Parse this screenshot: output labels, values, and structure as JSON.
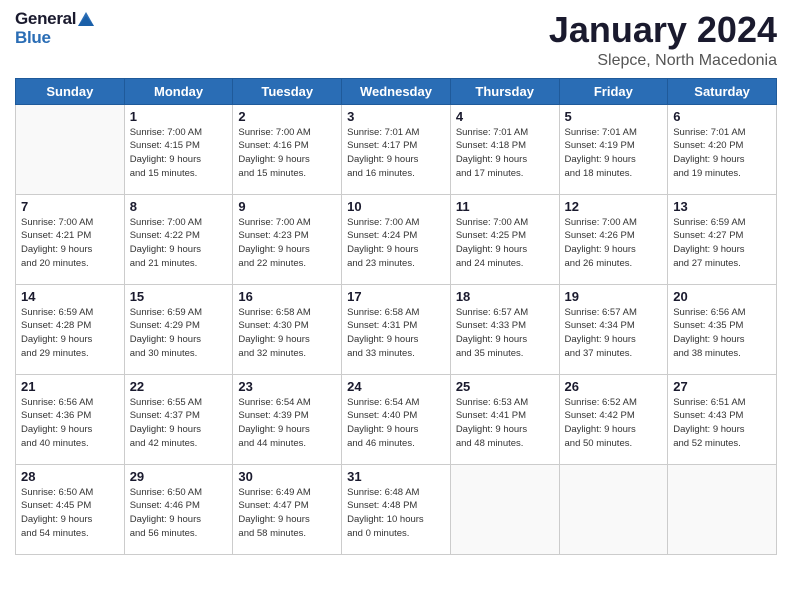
{
  "logo": {
    "line1": "General",
    "line2": "Blue"
  },
  "title": "January 2024",
  "location": "Slepce, North Macedonia",
  "days_of_week": [
    "Sunday",
    "Monday",
    "Tuesday",
    "Wednesday",
    "Thursday",
    "Friday",
    "Saturday"
  ],
  "weeks": [
    [
      {
        "day": "",
        "info": ""
      },
      {
        "day": "1",
        "info": "Sunrise: 7:00 AM\nSunset: 4:15 PM\nDaylight: 9 hours\nand 15 minutes."
      },
      {
        "day": "2",
        "info": "Sunrise: 7:00 AM\nSunset: 4:16 PM\nDaylight: 9 hours\nand 15 minutes."
      },
      {
        "day": "3",
        "info": "Sunrise: 7:01 AM\nSunset: 4:17 PM\nDaylight: 9 hours\nand 16 minutes."
      },
      {
        "day": "4",
        "info": "Sunrise: 7:01 AM\nSunset: 4:18 PM\nDaylight: 9 hours\nand 17 minutes."
      },
      {
        "day": "5",
        "info": "Sunrise: 7:01 AM\nSunset: 4:19 PM\nDaylight: 9 hours\nand 18 minutes."
      },
      {
        "day": "6",
        "info": "Sunrise: 7:01 AM\nSunset: 4:20 PM\nDaylight: 9 hours\nand 19 minutes."
      }
    ],
    [
      {
        "day": "7",
        "info": "Sunrise: 7:00 AM\nSunset: 4:21 PM\nDaylight: 9 hours\nand 20 minutes."
      },
      {
        "day": "8",
        "info": "Sunrise: 7:00 AM\nSunset: 4:22 PM\nDaylight: 9 hours\nand 21 minutes."
      },
      {
        "day": "9",
        "info": "Sunrise: 7:00 AM\nSunset: 4:23 PM\nDaylight: 9 hours\nand 22 minutes."
      },
      {
        "day": "10",
        "info": "Sunrise: 7:00 AM\nSunset: 4:24 PM\nDaylight: 9 hours\nand 23 minutes."
      },
      {
        "day": "11",
        "info": "Sunrise: 7:00 AM\nSunset: 4:25 PM\nDaylight: 9 hours\nand 24 minutes."
      },
      {
        "day": "12",
        "info": "Sunrise: 7:00 AM\nSunset: 4:26 PM\nDaylight: 9 hours\nand 26 minutes."
      },
      {
        "day": "13",
        "info": "Sunrise: 6:59 AM\nSunset: 4:27 PM\nDaylight: 9 hours\nand 27 minutes."
      }
    ],
    [
      {
        "day": "14",
        "info": "Sunrise: 6:59 AM\nSunset: 4:28 PM\nDaylight: 9 hours\nand 29 minutes."
      },
      {
        "day": "15",
        "info": "Sunrise: 6:59 AM\nSunset: 4:29 PM\nDaylight: 9 hours\nand 30 minutes."
      },
      {
        "day": "16",
        "info": "Sunrise: 6:58 AM\nSunset: 4:30 PM\nDaylight: 9 hours\nand 32 minutes."
      },
      {
        "day": "17",
        "info": "Sunrise: 6:58 AM\nSunset: 4:31 PM\nDaylight: 9 hours\nand 33 minutes."
      },
      {
        "day": "18",
        "info": "Sunrise: 6:57 AM\nSunset: 4:33 PM\nDaylight: 9 hours\nand 35 minutes."
      },
      {
        "day": "19",
        "info": "Sunrise: 6:57 AM\nSunset: 4:34 PM\nDaylight: 9 hours\nand 37 minutes."
      },
      {
        "day": "20",
        "info": "Sunrise: 6:56 AM\nSunset: 4:35 PM\nDaylight: 9 hours\nand 38 minutes."
      }
    ],
    [
      {
        "day": "21",
        "info": "Sunrise: 6:56 AM\nSunset: 4:36 PM\nDaylight: 9 hours\nand 40 minutes."
      },
      {
        "day": "22",
        "info": "Sunrise: 6:55 AM\nSunset: 4:37 PM\nDaylight: 9 hours\nand 42 minutes."
      },
      {
        "day": "23",
        "info": "Sunrise: 6:54 AM\nSunset: 4:39 PM\nDaylight: 9 hours\nand 44 minutes."
      },
      {
        "day": "24",
        "info": "Sunrise: 6:54 AM\nSunset: 4:40 PM\nDaylight: 9 hours\nand 46 minutes."
      },
      {
        "day": "25",
        "info": "Sunrise: 6:53 AM\nSunset: 4:41 PM\nDaylight: 9 hours\nand 48 minutes."
      },
      {
        "day": "26",
        "info": "Sunrise: 6:52 AM\nSunset: 4:42 PM\nDaylight: 9 hours\nand 50 minutes."
      },
      {
        "day": "27",
        "info": "Sunrise: 6:51 AM\nSunset: 4:43 PM\nDaylight: 9 hours\nand 52 minutes."
      }
    ],
    [
      {
        "day": "28",
        "info": "Sunrise: 6:50 AM\nSunset: 4:45 PM\nDaylight: 9 hours\nand 54 minutes."
      },
      {
        "day": "29",
        "info": "Sunrise: 6:50 AM\nSunset: 4:46 PM\nDaylight: 9 hours\nand 56 minutes."
      },
      {
        "day": "30",
        "info": "Sunrise: 6:49 AM\nSunset: 4:47 PM\nDaylight: 9 hours\nand 58 minutes."
      },
      {
        "day": "31",
        "info": "Sunrise: 6:48 AM\nSunset: 4:48 PM\nDaylight: 10 hours\nand 0 minutes."
      },
      {
        "day": "",
        "info": ""
      },
      {
        "day": "",
        "info": ""
      },
      {
        "day": "",
        "info": ""
      }
    ]
  ]
}
